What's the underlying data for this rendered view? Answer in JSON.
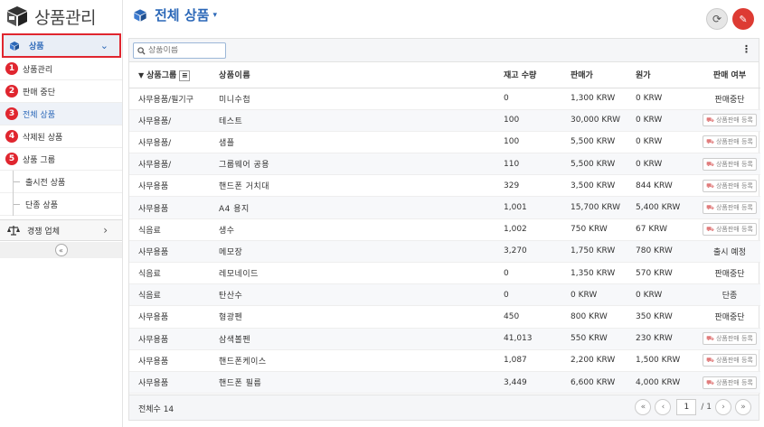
{
  "app": {
    "title": "상품관리"
  },
  "sidebar": {
    "section_label": "상품",
    "items": [
      {
        "num": "1",
        "label": "상품관리"
      },
      {
        "num": "2",
        "label": "판매 중단"
      },
      {
        "num": "3",
        "label": "전체 상품"
      },
      {
        "num": "4",
        "label": "삭제된 상품"
      },
      {
        "num": "5",
        "label": "상품 그룹"
      }
    ],
    "sub_items": [
      {
        "label": "출시전 상품"
      },
      {
        "label": "단종 상품"
      }
    ],
    "competitor_label": "경쟁 업체"
  },
  "page": {
    "title": "전체 상품"
  },
  "search": {
    "placeholder": "상품이름"
  },
  "table": {
    "headers": {
      "group": "상품그룹",
      "name": "상품이름",
      "stock": "재고 수량",
      "price": "판매가",
      "cost": "원가",
      "status": "판매 여부"
    },
    "register_label": "상품판매 등록",
    "rows": [
      {
        "group": "사무용품/필기구",
        "name": "미니수첩",
        "stock": "0",
        "price": "1,300 KRW",
        "cost": "0 KRW",
        "status": "판매중단"
      },
      {
        "group": "사무용품/",
        "name": "테스트",
        "stock": "100",
        "price": "30,000 KRW",
        "cost": "0 KRW",
        "status": "상품판매 등록"
      },
      {
        "group": "사무용품/",
        "name": "샘플",
        "stock": "100",
        "price": "5,500 KRW",
        "cost": "0 KRW",
        "status": "상품판매 등록"
      },
      {
        "group": "사무용품/",
        "name": "그룹웨어 공용",
        "stock": "110",
        "price": "5,500 KRW",
        "cost": "0 KRW",
        "status": "상품판매 등록"
      },
      {
        "group": "사무용품",
        "name": "핸드폰 거치대",
        "stock": "329",
        "price": "3,500 KRW",
        "cost": "844 KRW",
        "status": "상품판매 등록"
      },
      {
        "group": "사무용품",
        "name": "A4 용지",
        "stock": "1,001",
        "price": "15,700 KRW",
        "cost": "5,400 KRW",
        "status": "상품판매 등록"
      },
      {
        "group": "식음료",
        "name": "생수",
        "stock": "1,002",
        "price": "750 KRW",
        "cost": "67 KRW",
        "status": "상품판매 등록"
      },
      {
        "group": "사무용품",
        "name": "메모장",
        "stock": "3,270",
        "price": "1,750 KRW",
        "cost": "780 KRW",
        "status": "출시 예정"
      },
      {
        "group": "식음료",
        "name": "레모네이드",
        "stock": "0",
        "price": "1,350 KRW",
        "cost": "570 KRW",
        "status": "판매중단"
      },
      {
        "group": "식음료",
        "name": "탄산수",
        "stock": "0",
        "price": "0 KRW",
        "cost": "0 KRW",
        "status": "단종"
      },
      {
        "group": "사무용품",
        "name": "형광펜",
        "stock": "450",
        "price": "800 KRW",
        "cost": "350 KRW",
        "status": "판매중단"
      },
      {
        "group": "사무용품",
        "name": "삼색볼펜",
        "stock": "41,013",
        "price": "550 KRW",
        "cost": "230 KRW",
        "status": "상품판매 등록"
      },
      {
        "group": "사무용품",
        "name": "핸드폰케이스",
        "stock": "1,087",
        "price": "2,200 KRW",
        "cost": "1,500 KRW",
        "status": "상품판매 등록"
      },
      {
        "group": "사무용품",
        "name": "핸드폰 필름",
        "stock": "3,449",
        "price": "6,600 KRW",
        "cost": "4,000 KRW",
        "status": "상품판매 등록"
      }
    ]
  },
  "footer": {
    "count_label": "전체수 14",
    "page_current": "1",
    "page_total": "/ 1"
  },
  "colors": {
    "accent": "#2c68b8",
    "danger": "#e0262f"
  }
}
